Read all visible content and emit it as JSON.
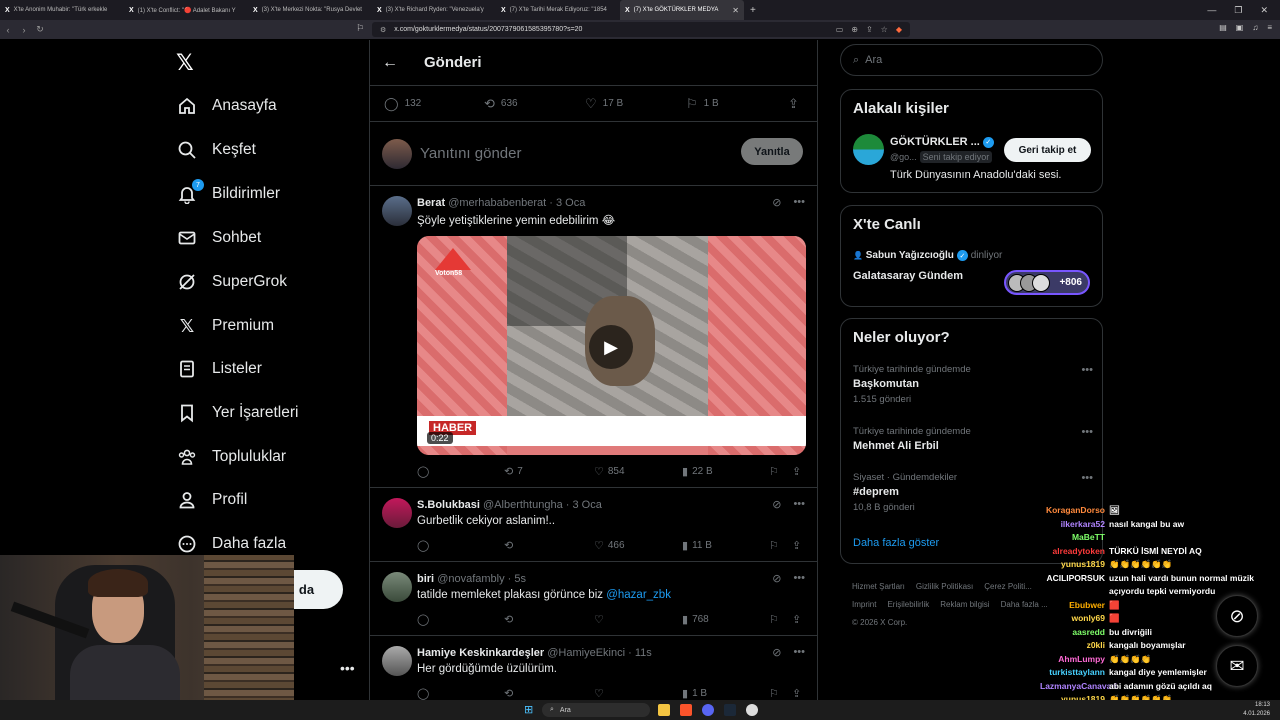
{
  "browser": {
    "tabs": [
      {
        "title": "X'te Anonim Muhabir: \"Türk erkekle"
      },
      {
        "title": "(1) X'te Conflict: \"🔴 Adalet Bakanı Y"
      },
      {
        "title": "(3) X'te Merkezi Nokta: \"Rusya Devlet"
      },
      {
        "title": "(3) X'te Richard Ryden: \"Venezuela'y"
      },
      {
        "title": "(7) X'te Tarihi Merak Ediyoruz: \"1854"
      },
      {
        "title": "(7) X'te GÖKTÜRKLER MEDYA"
      }
    ],
    "new_tab": "+",
    "url": "x.com/gokturklermedya/status/2007379061585395780?s=20"
  },
  "nav": {
    "items": [
      {
        "label": "Anasayfa"
      },
      {
        "label": "Keşfet"
      },
      {
        "label": "Bildirimler",
        "badge": "7"
      },
      {
        "label": "Sohbet"
      },
      {
        "label": "SuperGrok"
      },
      {
        "label": "Premium"
      },
      {
        "label": "Listeler"
      },
      {
        "label": "Yer İşaretleri"
      },
      {
        "label": "Topluluklar"
      },
      {
        "label": "Profil"
      },
      {
        "label": "Daha fazla"
      }
    ],
    "post_label": "da"
  },
  "main": {
    "title": "Gönderi",
    "stats": {
      "replies": "132",
      "reposts": "636",
      "likes": "17 B",
      "bookmarks": "1 B"
    },
    "reply_placeholder": "Yanıtını gönder",
    "reply_button": "Yanıtla",
    "tweets": [
      {
        "name": "Berat",
        "handle": "@merhababenberat",
        "time": "· 3 Oca",
        "text": "Şöyle yetiştiklerine yemin edebilirim 😂",
        "replies": "",
        "reposts": "7",
        "likes": "854",
        "views": "22 B",
        "media": {
          "logo": "Voton58",
          "lower_third": "HABER",
          "duration": "0:22"
        }
      },
      {
        "name": "S.Bolukbasi",
        "handle": "@Alberthtungha",
        "time": "· 3 Oca",
        "text": "Gurbetlik cekiyor aslanim!..",
        "replies": "",
        "reposts": "",
        "likes": "466",
        "views": "11 B"
      },
      {
        "name": "biri",
        "handle": "@novafambly",
        "time": "· 5s",
        "text": "tatilde memleket plakası görünce biz",
        "mention": "@hazar_zbk",
        "replies": "",
        "reposts": "",
        "likes": "",
        "views": "768"
      },
      {
        "name": "Hamiye Keskinkardeşler",
        "handle": "@HamiyeEkinci",
        "time": "· 11s",
        "text": "Her gördüğümde üzülürüm.",
        "views": "1 B"
      }
    ]
  },
  "right": {
    "search_placeholder": "Ara",
    "related": {
      "title": "Alakalı kişiler",
      "name": "GÖKTÜRKLER ...",
      "handle": "@go...",
      "follows_you": "Seni takip ediyor",
      "bio": "Türk Dünyasının Anadolu'daki sesi.",
      "follow_button": "Geri takip et"
    },
    "live": {
      "title": "X'te Canlı",
      "host": "Sabun Yağızcıoğlu",
      "status": "dinliyor",
      "space": "Galatasaray Gündem",
      "listeners": "+806"
    },
    "trends": {
      "title": "Neler oluyor?",
      "items": [
        {
          "context": "Türkiye tarihinde gündemde",
          "topic": "Başkomutan",
          "count": "1.515 gönderi"
        },
        {
          "context": "Türkiye tarihinde gündemde",
          "topic": "Mehmet Ali Erbil",
          "count": ""
        },
        {
          "context": "Siyaset · Gündemdekiler",
          "topic": "#deprem",
          "count": "10,8 B gönderi"
        }
      ],
      "show_more": "Daha fazla göster"
    },
    "footer": [
      "Hizmet Şartları",
      "Gizlilik Politikası",
      "Çerez Politi...",
      "Imprint",
      "Erişilebilirlik",
      "Reklam bilgisi",
      "Daha fazla ...",
      "© 2026 X Corp."
    ]
  },
  "chat": [
    {
      "user": "KoraganDorso",
      "msg": "🖼",
      "color": "#ff8a3d"
    },
    {
      "user": "ilkerkara52",
      "msg": "nasıl kangal bu aw",
      "color": "#b084ff"
    },
    {
      "user": "MaBeTT",
      "msg": "",
      "color": "#7fff6a"
    },
    {
      "user": "alreadytoken",
      "msg": "TÜRKÜ İSMİ NEYDİ AQ",
      "color": "#ff3b3b"
    },
    {
      "user": "yunus1819",
      "msg": "👏👏👏👏👏👏",
      "color": "#ffd84a"
    },
    {
      "user": "ACILIPORSUK",
      "msg": "uzun hali vardı bunun normal müzik",
      "color": "#ffffff"
    },
    {
      "user": "",
      "msg": "açıyordu tepki vermiyordu",
      "color": "#ffffff"
    },
    {
      "user": "Ebubwer",
      "msg": "🟥",
      "color": "#ffae00"
    },
    {
      "user": "wonly69",
      "msg": "🟥",
      "color": "#ffd84a"
    },
    {
      "user": "aasredd",
      "msg": "bu divriğili",
      "color": "#7fff6a"
    },
    {
      "user": "z0kli",
      "msg": "kangalı boyamışlar",
      "color": "#ffd84a"
    },
    {
      "user": "AhmLumpy",
      "msg": "👏👏👏👏",
      "color": "#ff6ad5"
    },
    {
      "user": "turkisttaylann",
      "msg": "kangal diye yemlemişler",
      "color": "#47d1ff"
    },
    {
      "user": "LazmanyaCanavari",
      "msg": "abi adamın gözü açıldı aq",
      "color": "#b084ff"
    },
    {
      "user": "yunus1819",
      "msg": "👏👏👏👏👏👏",
      "color": "#ffd84a"
    }
  ],
  "taskbar": {
    "search": "Ara",
    "time": "18:13",
    "date": "4.01.2026"
  }
}
